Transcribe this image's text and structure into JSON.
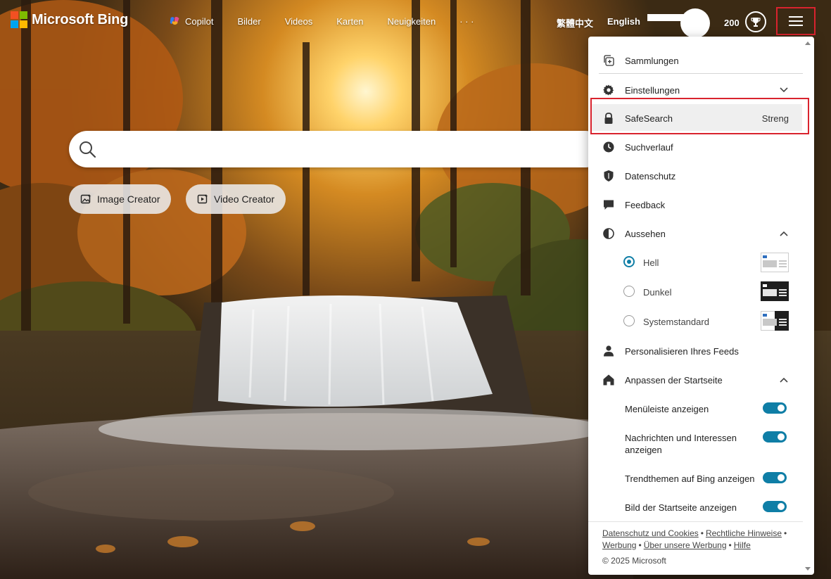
{
  "brand": {
    "name": "Microsoft Bing",
    "colors": {
      "red": "#f25022",
      "green": "#7fba00",
      "blue": "#00a4ef",
      "yellow": "#ffb900"
    }
  },
  "nav": {
    "copilot": "Copilot",
    "bilder": "Bilder",
    "videos": "Videos",
    "karten": "Karten",
    "neuigkeiten": "Neuigkeiten",
    "more": "· · ·"
  },
  "header": {
    "lang_zh": "繁體中文",
    "lang_en": "English",
    "rewards_count": "200"
  },
  "search": {
    "value": "",
    "placeholder": ""
  },
  "creators": {
    "image": "Image Creator",
    "video": "Video Creator"
  },
  "menu": {
    "sammlungen": "Sammlungen",
    "einstellungen": "Einstellungen",
    "safesearch": "SafeSearch",
    "safesearch_value": "Streng",
    "suchverlauf": "Suchverlauf",
    "datenschutz": "Datenschutz",
    "feedback": "Feedback",
    "aussehen": "Aussehen",
    "themes": {
      "hell": "Hell",
      "dunkel": "Dunkel",
      "system": "Systemstandard",
      "selected": "Hell"
    },
    "personalisieren": "Personalisieren Ihres Feeds",
    "anpassen": "Anpassen der Startseite",
    "toggles": {
      "menueleiste": "Menüleiste anzeigen",
      "nachrichten": "Nachrichten und Interessen anzeigen",
      "trend": "Trendthemen auf Bing anzeigen",
      "bild": "Bild der Startseite anzeigen"
    },
    "footer": {
      "datenschutz_cookies": "Datenschutz und Cookies",
      "rechtliche": "Rechtliche Hinweise",
      "werbung": "Werbung",
      "ueber_werbung": "Über unsere Werbung",
      "hilfe": "Hilfe",
      "separator": "•",
      "copyright": "© 2025 Microsoft"
    },
    "accent": "#0f7ea6",
    "highlight": "#d9232e"
  }
}
